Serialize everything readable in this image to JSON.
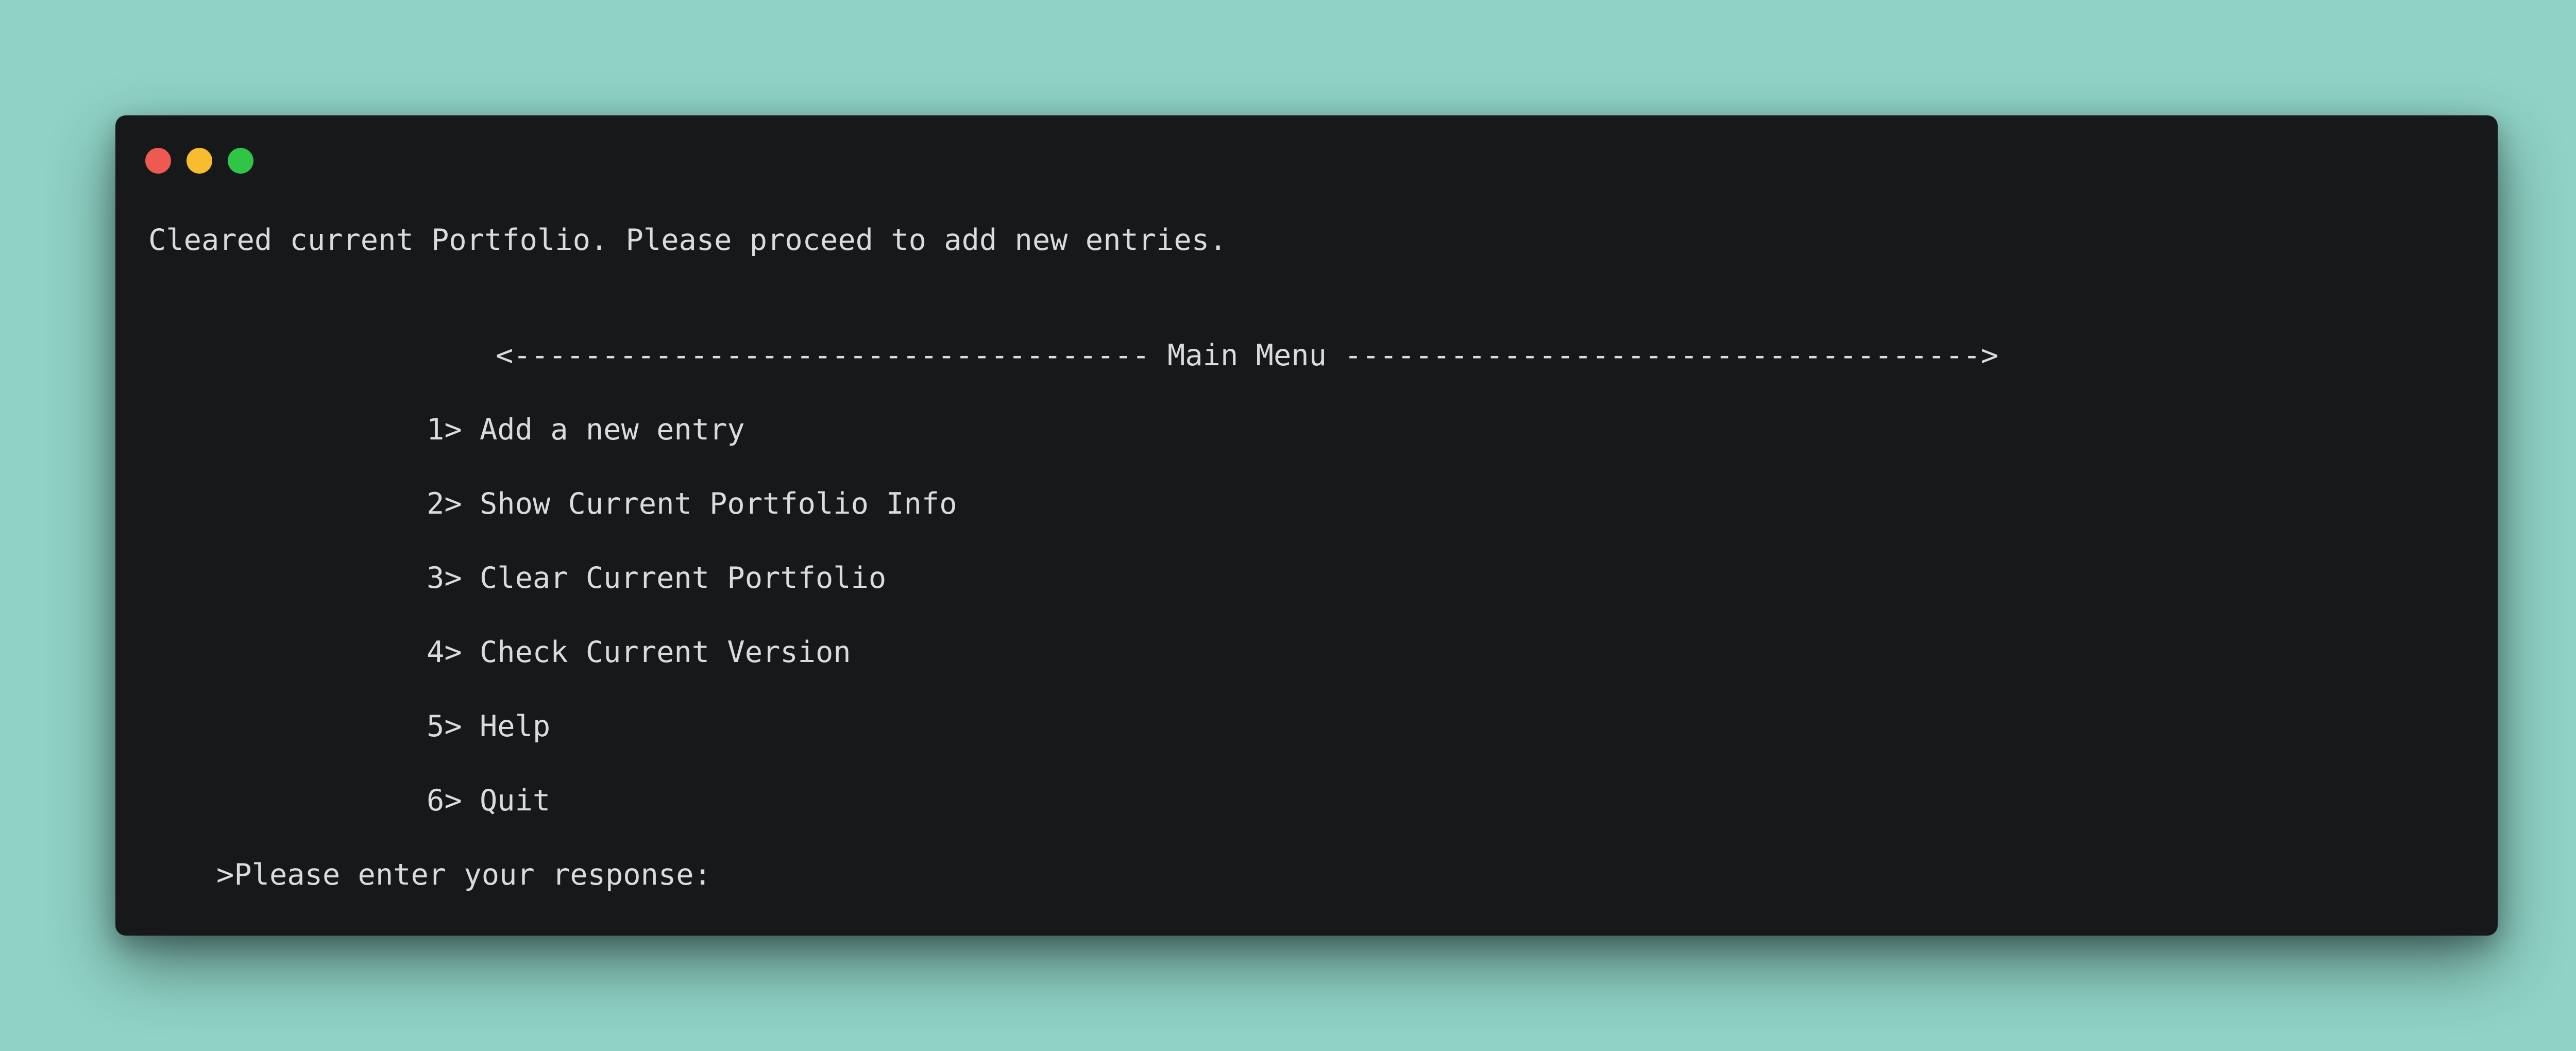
{
  "window": {
    "controls": {
      "close_color": "#ee5a52",
      "minimize_color": "#f7bd2f",
      "maximize_color": "#31c548"
    }
  },
  "terminal": {
    "status_message": "Cleared current Portfolio. Please proceed to add new entries.",
    "menu_header": "<------------------------------------ Main Menu ------------------------------------>",
    "menu_items": [
      {
        "label": "1> Add a new entry"
      },
      {
        "label": "2> Show Current Portfolio Info"
      },
      {
        "label": "3> Clear Current Portfolio"
      },
      {
        "label": "4> Check Current Version"
      },
      {
        "label": "5> Help"
      },
      {
        "label": "6> Quit"
      }
    ],
    "prompt": ">Please enter your response:",
    "input_value": ""
  }
}
